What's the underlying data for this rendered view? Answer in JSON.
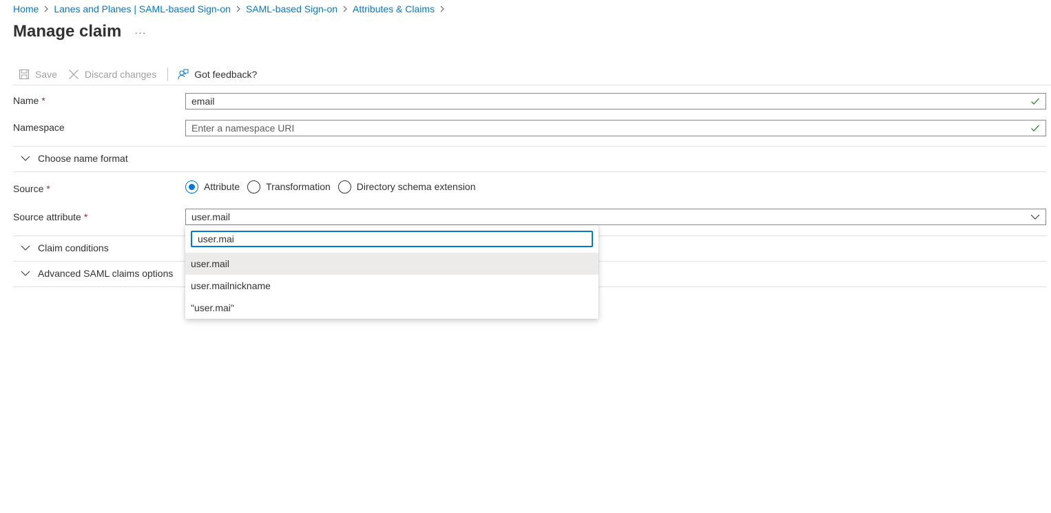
{
  "breadcrumb": {
    "items": [
      "Home",
      "Lanes and Planes | SAML-based Sign-on",
      "SAML-based Sign-on",
      "Attributes & Claims"
    ]
  },
  "page": {
    "title": "Manage claim",
    "more_label": "···"
  },
  "toolbar": {
    "save_label": "Save",
    "discard_label": "Discard changes",
    "feedback_label": "Got feedback?"
  },
  "form": {
    "name_label": "Name",
    "name_value": "email",
    "namespace_label": "Namespace",
    "namespace_placeholder": "Enter a namespace URI",
    "required_marker": "*",
    "name_format_label": "Choose name format",
    "source_label": "Source",
    "source_options": [
      "Attribute",
      "Transformation",
      "Directory schema extension"
    ],
    "source_selected": "Attribute",
    "source_attribute_label": "Source attribute",
    "source_attribute_value": "user.mail",
    "claim_conditions_label": "Claim conditions",
    "advanced_label": "Advanced SAML claims options"
  },
  "dropdown": {
    "search_value": "user.mai",
    "options": [
      "user.mail",
      "user.mailnickname",
      "\"user.mai\""
    ],
    "selected": "user.mail"
  },
  "colors": {
    "link": "#0078d4",
    "required": "#a4262c",
    "valid_check": "#107c10",
    "focus_border": "#0078d4",
    "option_selected_bg": "#edebe9"
  },
  "icons": {
    "save": "floppy-disk-icon",
    "discard": "close-icon",
    "feedback": "feedback-person-icon",
    "valid": "checkmark-icon",
    "expand": "chevron-down-icon",
    "crumb_sep": "chevron-right-icon"
  }
}
